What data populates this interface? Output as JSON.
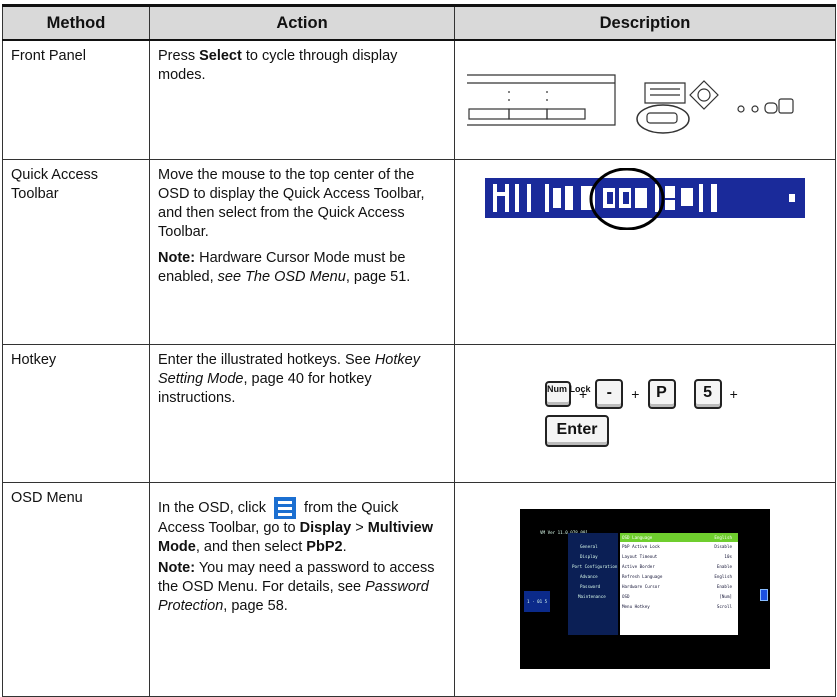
{
  "headers": {
    "method": "Method",
    "action": "Action",
    "description": "Description"
  },
  "rows": [
    {
      "method": "Front Panel",
      "action_pre": "Press ",
      "action_bold": "Select",
      "action_post": " to cycle through display modes."
    },
    {
      "method": "Quick Access Toolbar",
      "action": "Move the mouse to the top center of the OSD to display the Quick Access Toolbar, and then select from the Quick Access Toolbar.",
      "note_label": "Note:",
      "note_text": " Hardware Cursor Mode must be enabled, ",
      "note_see": "see The OSD Menu",
      "note_page": ", page 51."
    },
    {
      "method": "Hotkey",
      "action_pre": "Enter the illustrated hotkeys. See ",
      "action_link": "Hotkey Setting Mode",
      "action_post": ", page 40 for hotkey instructions.",
      "keys": [
        "Num Lock",
        "-",
        "P",
        "5",
        "Enter"
      ],
      "plus": "+"
    },
    {
      "method": "OSD Menu",
      "a1": "In the OSD, click ",
      "a2": " from the Quick Access Toolbar, go to ",
      "display": "Display",
      "gt": " > ",
      "multiview": "Multiview Mode",
      "a3": ", and then select ",
      "pbp": "PbP2",
      "a4": ".",
      "note_label": "Note:",
      "note_text": " You may need a password to access the OSD Menu. For details, see ",
      "note_link": "Password Protection",
      "note_page": ", page 58."
    }
  ],
  "osd": {
    "title": "VM Ver 11.0.078.001",
    "tabs": [
      "General",
      "Display",
      "Port Configuration",
      "Advance",
      "Password",
      "Maintenance"
    ],
    "items": [
      "OSD Language",
      "PbP Active Lock",
      "Layout Timeout",
      "Active Border",
      "Refresh Language",
      "Hardware Cursor",
      "OSD",
      "Menu Hotkey"
    ],
    "values": [
      "English",
      "Disable",
      "10s",
      "Enable",
      "English",
      "Enable",
      "[Num]",
      "Scroll"
    ],
    "side_label": "1 · 01 5"
  }
}
